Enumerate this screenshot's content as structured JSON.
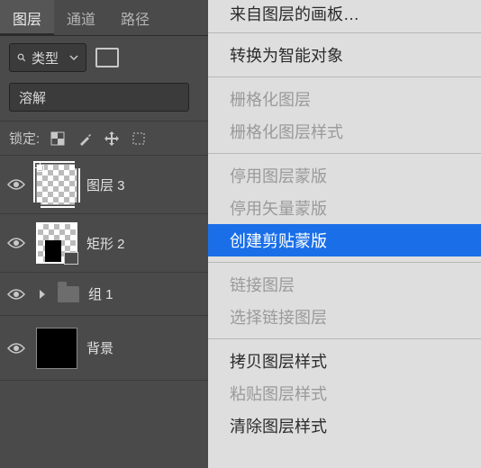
{
  "tabs": {
    "layers": "图层",
    "channels": "通道",
    "paths": "路径"
  },
  "filter": {
    "type_label": "类型"
  },
  "blend": {
    "mode": "溶解"
  },
  "lock": {
    "label": "锁定:"
  },
  "layers": {
    "l3": "图层 3",
    "rect2": "矩形 2",
    "group1": "组 1",
    "bg": "背景"
  },
  "menu": {
    "artboard_from_layers": "来自图层的画板…",
    "convert_smart": "转换为智能对象",
    "rasterize_layer": "栅格化图层",
    "rasterize_style": "栅格化图层样式",
    "disable_layer_mask": "停用图层蒙版",
    "disable_vector_mask": "停用矢量蒙版",
    "create_clipping_mask": "创建剪贴蒙版",
    "link_layers": "链接图层",
    "select_linked": "选择链接图层",
    "copy_style": "拷贝图层样式",
    "paste_style": "粘贴图层样式",
    "clear_style": "清除图层样式"
  }
}
